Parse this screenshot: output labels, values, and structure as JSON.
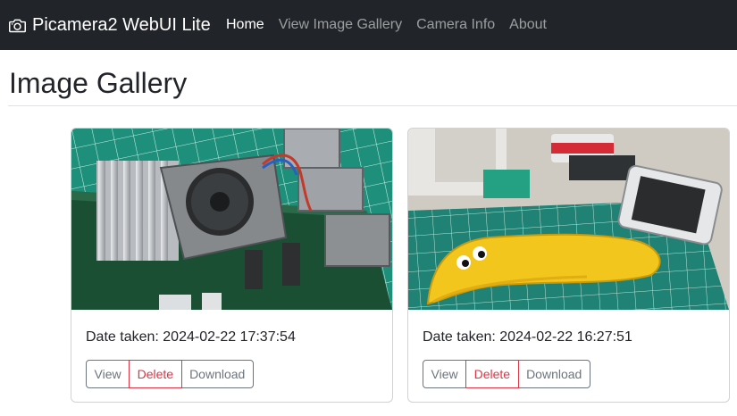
{
  "navbar": {
    "brand": "Picamera2 WebUI Lite",
    "brand_icon": "camera-icon",
    "links": [
      {
        "label": "Home",
        "active": true
      },
      {
        "label": "View Image Gallery",
        "active": false
      },
      {
        "label": "Camera Info",
        "active": false
      },
      {
        "label": "About",
        "active": false
      }
    ]
  },
  "page": {
    "title": "Image Gallery"
  },
  "gallery": {
    "items": [
      {
        "image": "raspberry-pi-5-with-active-cooler-photo",
        "date_text": "Date taken: 2024-02-22 17:37:54",
        "buttons": {
          "view": "View",
          "delete": "Delete",
          "download": "Download"
        }
      },
      {
        "image": "banana-for-scale-on-cutting-mat-photo",
        "date_text": "Date taken: 2024-02-22 16:27:51",
        "buttons": {
          "view": "View",
          "delete": "Delete",
          "download": "Download"
        }
      }
    ]
  },
  "colors": {
    "navbar_bg": "#212529",
    "nav_active": "#ffffff",
    "nav_inactive": "#8c8e91",
    "secondary": "#6c757d",
    "danger": "#dc3545"
  }
}
